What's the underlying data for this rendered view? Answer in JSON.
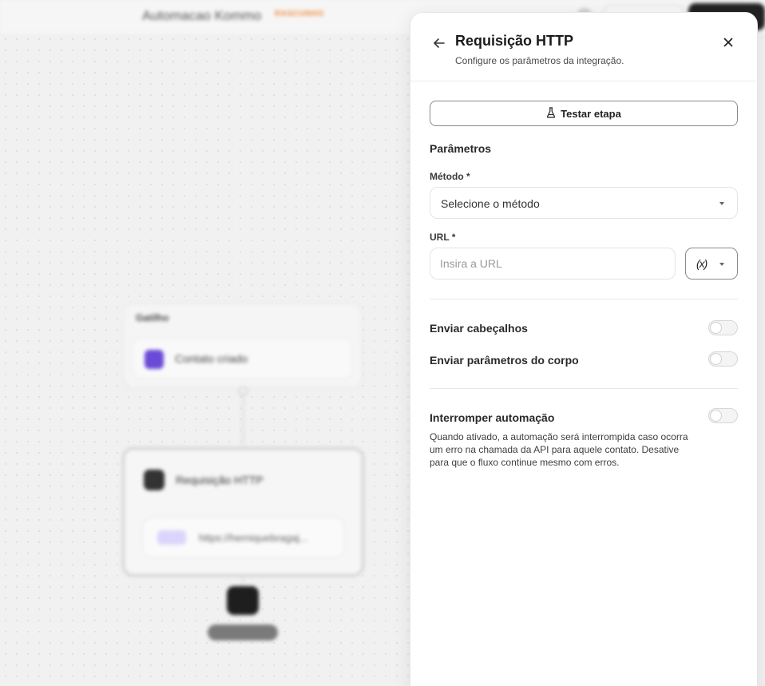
{
  "background": {
    "workflow_name": "Automacao Kommo",
    "status_badge": "RASCUNHO",
    "trigger": {
      "header": "Gatilho",
      "event": "Contato criado",
      "color": "#6a4bd8"
    },
    "http_step": {
      "title": "Requisição HTTP",
      "method_badge": "POST",
      "url_preview": "https://herniquebragaj..."
    },
    "end_label": "Fim do fluxo"
  },
  "panel": {
    "title": "Requisição HTTP",
    "subtitle": "Configure os parâmetros da integração.",
    "back_icon": "arrow-left-icon",
    "close_icon": "close-icon",
    "test_button": {
      "label": "Testar etapa",
      "icon": "flask-icon"
    },
    "parameters_title": "Parâmetros",
    "method": {
      "label": "Método *",
      "value": "Selecione o método"
    },
    "url": {
      "label": "URL *",
      "placeholder": "Insira a URL",
      "value": "",
      "variable_glyph": "(x)"
    },
    "toggles": {
      "send_headers": {
        "label": "Enviar cabeçalhos",
        "enabled": false
      },
      "send_body": {
        "label": "Enviar parâmetros do corpo",
        "enabled": false
      },
      "stop_automation": {
        "label": "Interromper automação",
        "enabled": false,
        "description": "Quando ativado, a automação será interrompida caso ocorra um erro na chamada da API para aquele contato. Desative para que o fluxo continue mesmo com erros."
      }
    }
  }
}
